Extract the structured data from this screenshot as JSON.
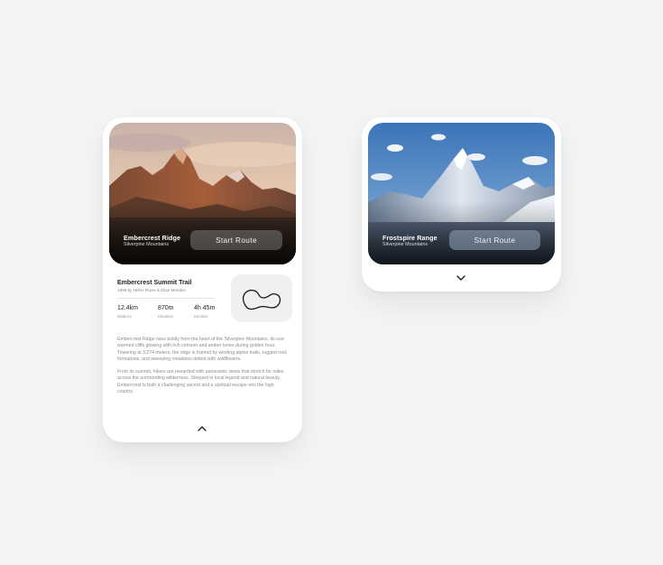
{
  "left_card": {
    "hero": {
      "title": "Embercrest Ridge",
      "subtitle": "Silverpine Mountains",
      "button_label": "Start Route"
    },
    "trail": {
      "title": "Embercrest Summit Trail",
      "author": "1896 by Helen Rowe & Elias Mendez",
      "stats": [
        {
          "value": "12.4km",
          "label": "Distance"
        },
        {
          "value": "870m",
          "label": "Elevation"
        },
        {
          "value": "4h 45m",
          "label": "Duration"
        }
      ],
      "map_icon": "route-map-icon"
    },
    "description": [
      "Embercrest Ridge rises boldly from the heart of the Silverpine Mountains, its sun-warmed cliffs glowing with rich crimson and amber tones during golden hour. Towering at 3,274 meters, the ridge is framed by winding alpine trails, rugged rock formations, and sweeping meadows dotted with wildflowers.",
      "From its summit, hikers are rewarded with panoramic views that stretch for miles across the surrounding wilderness. Steeped in local legend and natural beauty, Embercrest is both a challenging ascent and a spiritual escape into the high country."
    ],
    "collapse_icon": "chevron-up-icon"
  },
  "right_card": {
    "hero": {
      "title": "Frostspire Range",
      "subtitle": "Silverpine Mountains",
      "button_label": "Start Route"
    },
    "expand_icon": "chevron-down-icon"
  },
  "colors": {
    "page_bg": "#f4f4f4",
    "card_bg": "#ffffff",
    "text_dark": "#222222",
    "text_muted": "#8c8c8c"
  }
}
